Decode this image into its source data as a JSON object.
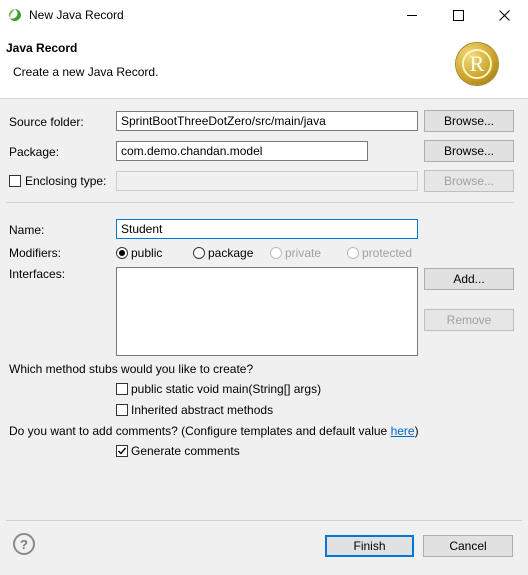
{
  "window": {
    "title": "New Java Record"
  },
  "header": {
    "title": "Java Record",
    "subtitle": "Create a new Java Record.",
    "logo_letter": "R"
  },
  "source_folder": {
    "label": "Source folder:",
    "value": "SprintBootThreeDotZero/src/main/java",
    "browse": "Browse..."
  },
  "package": {
    "label": "Package:",
    "value": "com.demo.chandan.model",
    "browse": "Browse..."
  },
  "enclosing_type": {
    "label": "Enclosing type:",
    "checked": false,
    "value": "",
    "browse": "Browse..."
  },
  "name": {
    "label": "Name:",
    "value": "Student"
  },
  "modifiers": {
    "label": "Modifiers:",
    "options": [
      {
        "label": "public",
        "selected": true,
        "enabled": true
      },
      {
        "label": "package",
        "selected": false,
        "enabled": true
      },
      {
        "label": "private",
        "selected": false,
        "enabled": false
      },
      {
        "label": "protected",
        "selected": false,
        "enabled": false
      }
    ]
  },
  "interfaces": {
    "label": "Interfaces:",
    "add": "Add...",
    "remove": "Remove"
  },
  "stubs": {
    "question": "Which method stubs would you like to create?",
    "main": {
      "label": "public static void main(String[] args)",
      "checked": false
    },
    "inherited": {
      "label": "Inherited abstract methods",
      "checked": false
    }
  },
  "comments": {
    "question": "Do you want to add comments? (Configure templates and default value",
    "link": "here",
    "close": ")",
    "generate": {
      "label": "Generate comments",
      "checked": true
    }
  },
  "footer": {
    "finish": "Finish",
    "cancel": "Cancel"
  },
  "colors": {
    "accent": "#0078d7",
    "logo_gold": "#c8a028",
    "eclipse_green": "#3f9b2c"
  }
}
